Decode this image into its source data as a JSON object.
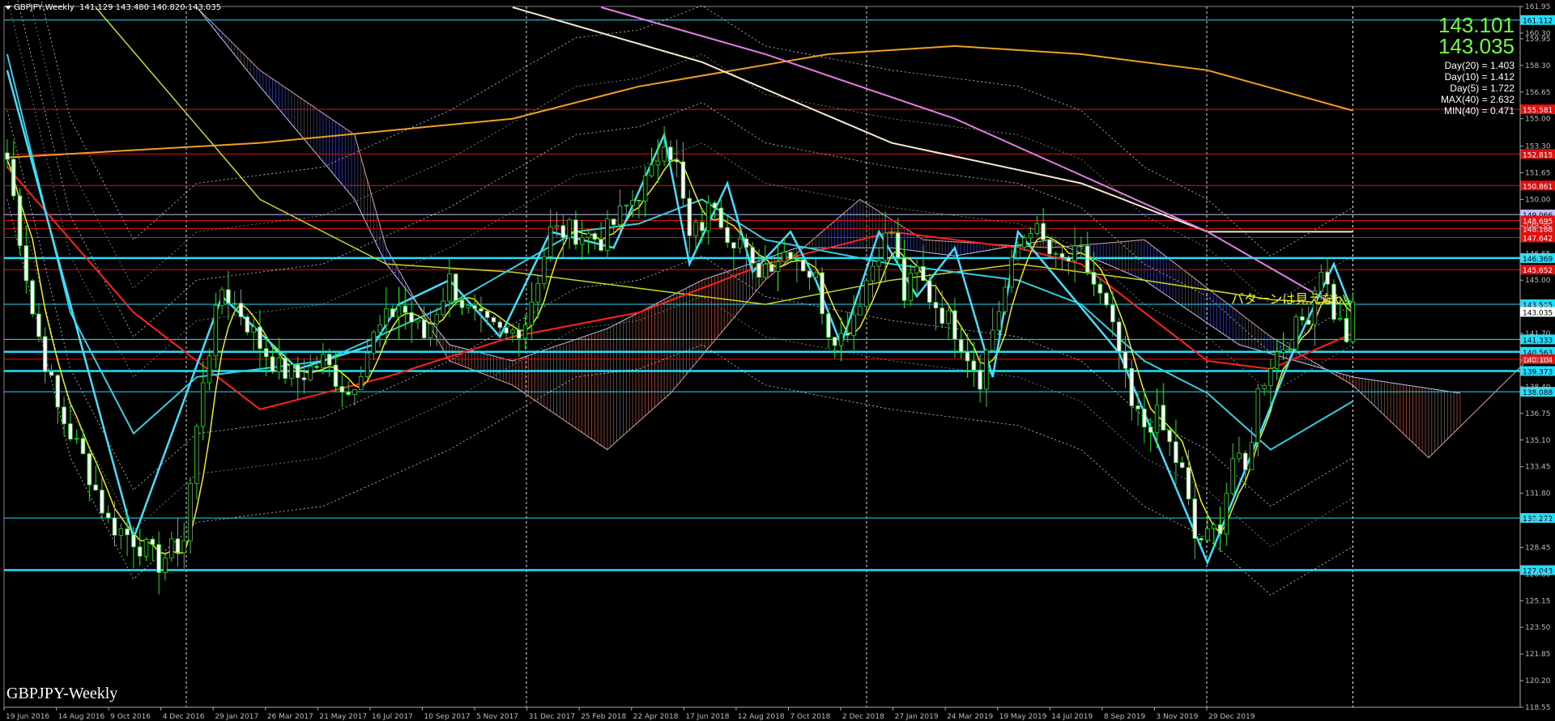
{
  "header": {
    "symbol": "GBPJPY,Weekly",
    "ohlc": "141.129 143.480 140.820 143.035"
  },
  "price_display": {
    "bid": "143.101",
    "ask": "143.035"
  },
  "stats": [
    "Day(20) = 1.403",
    "Day(10) = 1.412",
    "Day(5) = 1.722",
    "MAX(40) = 2.632",
    "MIN(40) = 0.471"
  ],
  "watermark": "GBPJPY-Weekly",
  "annotation": "パターンは見えない。",
  "colors": {
    "background": "#000000",
    "bull": "#22dd22",
    "bear": "#ffffff",
    "ma_red": "#ff2020",
    "ma_yellow": "#f0f000",
    "ma_cyan": "#30d0e0",
    "ma_orange": "#f0a020",
    "ma_white": "#ffffff",
    "ma_pink": "#e080e0",
    "level_cyan": "#20e0ff",
    "level_red": "#e01010",
    "cloud_up": "#c06040",
    "cloud_down": "#4050c0",
    "price_green": "#6cff3a"
  },
  "chart_data": {
    "type": "candlestick",
    "title": "GBPJPY-Weekly",
    "ylim": [
      118.55,
      161.95
    ],
    "y_ticks": [
      "161.95",
      "160.30",
      "159.95",
      "158.30",
      "156.65",
      "155.00",
      "153.30",
      "151.65",
      "150.00",
      "148.35",
      "146.65",
      "145.00",
      "143.35",
      "141.70",
      "140.05",
      "138.40",
      "136.75",
      "135.10",
      "133.45",
      "131.80",
      "130.15",
      "128.45",
      "126.80",
      "125.15",
      "123.50",
      "121.85",
      "120.20",
      "118.55"
    ],
    "x_labels": [
      "19 Jun 2016",
      "14 Aug 2016",
      "9 Oct 2016",
      "4 Dec 2016",
      "29 Jan 2017",
      "26 Mar 2017",
      "21 May 2017",
      "16 Jul 2017",
      "10 Sep 2017",
      "5 Nov 2017",
      "31 Dec 2017",
      "25 Feb 2018",
      "22 Apr 2018",
      "17 Jun 2018",
      "12 Aug 2018",
      "7 Oct 2018",
      "2 Dec 2018",
      "27 Jan 2019",
      "24 Mar 2019",
      "19 May 2019",
      "14 Jul 2019",
      "8 Sep 2019",
      "3 Nov 2019",
      "29 Dec 2019"
    ],
    "horizontal_levels": [
      {
        "value": 161.112,
        "label": "161.112",
        "color": "#20e0ff"
      },
      {
        "value": 155.581,
        "label": "155.581",
        "color": "#e01010"
      },
      {
        "value": 152.815,
        "label": "152.815",
        "color": "#e01010"
      },
      {
        "value": 150.861,
        "label": "150.861",
        "color": "#e01010"
      },
      {
        "value": 149.066,
        "label": "149.066",
        "color": "#c0c0ff"
      },
      {
        "value": 148.695,
        "label": "148.695",
        "color": "#e01010"
      },
      {
        "value": 148.188,
        "label": "148.188",
        "color": "#e01010"
      },
      {
        "value": 147.642,
        "label": "147.642",
        "color": "#e01010"
      },
      {
        "value": 146.369,
        "label": "146.369",
        "color": "#20e0ff"
      },
      {
        "value": 145.652,
        "label": "145.652",
        "color": "#e01010"
      },
      {
        "value": 143.505,
        "label": "143.505",
        "color": "#20e0ff"
      },
      {
        "value": 141.333,
        "label": "141.333",
        "color": "#20e0ff"
      },
      {
        "value": 140.563,
        "label": "140.563",
        "color": "#20e0ff"
      },
      {
        "value": 140.104,
        "label": "140.104",
        "color": "#e01010"
      },
      {
        "value": 139.373,
        "label": "139.373",
        "color": "#20e0ff"
      },
      {
        "value": 138.088,
        "label": "138.088",
        "color": "#20e0ff"
      },
      {
        "value": 130.272,
        "label": "130.272",
        "color": "#20e0ff"
      },
      {
        "value": 127.043,
        "label": "127.043",
        "color": "#20e0ff"
      }
    ],
    "current_price": {
      "value": 143.035,
      "label": "143.035"
    },
    "candles_close_keypoints": [
      [
        0,
        152.5
      ],
      [
        4,
        143
      ],
      [
        8,
        137
      ],
      [
        12,
        134
      ],
      [
        16,
        130
      ],
      [
        20,
        129
      ],
      [
        24,
        127.5
      ],
      [
        28,
        129
      ],
      [
        31,
        139
      ],
      [
        34,
        144.5
      ],
      [
        37,
        143
      ],
      [
        40,
        141
      ],
      [
        43,
        139.5
      ],
      [
        46,
        139
      ],
      [
        50,
        140
      ],
      [
        54,
        138
      ],
      [
        58,
        141.5
      ],
      [
        62,
        143.5
      ],
      [
        66,
        141.5
      ],
      [
        70,
        145
      ],
      [
        73,
        143
      ],
      [
        76,
        142
      ],
      [
        79,
        141.5
      ],
      [
        82,
        142.5
      ],
      [
        86,
        148
      ],
      [
        90,
        148
      ],
      [
        94,
        147.5
      ],
      [
        98,
        149.5
      ],
      [
        102,
        151.5
      ],
      [
        104,
        154
      ],
      [
        106,
        152
      ],
      [
        108,
        147.5
      ],
      [
        110,
        148.5
      ],
      [
        112,
        150
      ],
      [
        114,
        148
      ],
      [
        116,
        147.5
      ],
      [
        118,
        145.5
      ],
      [
        120,
        146
      ],
      [
        124,
        147
      ],
      [
        128,
        145
      ],
      [
        130,
        142
      ],
      [
        132,
        141.5
      ],
      [
        134,
        143
      ],
      [
        138,
        147
      ],
      [
        140,
        148
      ],
      [
        142,
        144
      ],
      [
        144,
        145.5
      ],
      [
        146,
        144
      ],
      [
        150,
        142
      ],
      [
        152,
        140.5
      ],
      [
        154,
        139
      ],
      [
        156,
        142
      ],
      [
        160,
        147
      ],
      [
        162,
        148.5
      ],
      [
        166,
        146
      ],
      [
        170,
        146.5
      ],
      [
        174,
        143
      ],
      [
        176,
        140.5
      ],
      [
        178,
        137
      ],
      [
        180,
        136
      ],
      [
        182,
        136.5
      ],
      [
        186,
        133
      ],
      [
        188,
        129
      ],
      [
        190,
        129
      ],
      [
        192,
        130
      ],
      [
        194,
        134
      ],
      [
        196,
        133
      ],
      [
        198,
        138
      ],
      [
        200,
        140
      ],
      [
        202,
        141
      ],
      [
        206,
        143
      ],
      [
        208,
        146
      ],
      [
        210,
        143
      ],
      [
        212,
        141.5
      ],
      [
        213,
        143
      ]
    ],
    "ma_red": [
      [
        0,
        152
      ],
      [
        20,
        143
      ],
      [
        40,
        137
      ],
      [
        60,
        139
      ],
      [
        80,
        141.5
      ],
      [
        100,
        143
      ],
      [
        120,
        146
      ],
      [
        140,
        148
      ],
      [
        160,
        147
      ],
      [
        170,
        146
      ],
      [
        180,
        143
      ],
      [
        190,
        140
      ],
      [
        200,
        139.5
      ],
      [
        213,
        141.7
      ]
    ],
    "ma_yellow_long": [
      [
        14,
        161.9
      ],
      [
        40,
        150
      ],
      [
        60,
        146
      ],
      [
        80,
        145.5
      ],
      [
        100,
        144.5
      ],
      [
        120,
        143.5
      ],
      [
        140,
        145
      ],
      [
        160,
        146
      ],
      [
        180,
        145
      ],
      [
        200,
        143.8
      ],
      [
        213,
        143.5
      ]
    ],
    "ma_cyan": [
      [
        0,
        159
      ],
      [
        10,
        143
      ],
      [
        20,
        135.5
      ],
      [
        30,
        139
      ],
      [
        50,
        140
      ],
      [
        70,
        143.5
      ],
      [
        90,
        148
      ],
      [
        100,
        148.5
      ],
      [
        110,
        150
      ],
      [
        120,
        147.5
      ],
      [
        140,
        146
      ],
      [
        160,
        145
      ],
      [
        170,
        143.5
      ],
      [
        180,
        140
      ],
      [
        190,
        138
      ],
      [
        200,
        134.5
      ],
      [
        213,
        137.5
      ]
    ],
    "ma_orange": [
      [
        0,
        152.6
      ],
      [
        40,
        153.5
      ],
      [
        80,
        155
      ],
      [
        100,
        157
      ],
      [
        130,
        159
      ],
      [
        150,
        159.5
      ],
      [
        170,
        159
      ],
      [
        190,
        158
      ],
      [
        213,
        155.5
      ]
    ],
    "ma_white": [
      [
        80,
        161.9
      ],
      [
        110,
        158.5
      ],
      [
        140,
        153.5
      ],
      [
        170,
        151
      ],
      [
        190,
        148
      ],
      [
        213,
        148
      ]
    ],
    "ma_pink": [
      [
        94,
        161.9
      ],
      [
        120,
        159
      ],
      [
        150,
        155
      ],
      [
        170,
        151.5
      ],
      [
        190,
        148
      ],
      [
        210,
        143.5
      ]
    ],
    "ichimoku_span_a": [
      [
        30,
        161.9
      ],
      [
        40,
        157
      ],
      [
        55,
        150
      ],
      [
        60,
        146
      ],
      [
        70,
        141
      ],
      [
        80,
        140
      ],
      [
        95,
        142
      ],
      [
        110,
        145
      ],
      [
        125,
        147
      ],
      [
        140,
        147
      ],
      [
        150,
        146.5
      ],
      [
        165,
        147.5
      ],
      [
        180,
        145
      ],
      [
        195,
        141
      ],
      [
        213,
        139
      ],
      [
        230,
        138
      ]
    ],
    "ichimoku_span_b": [
      [
        30,
        161.9
      ],
      [
        40,
        158
      ],
      [
        55,
        154
      ],
      [
        60,
        147
      ],
      [
        70,
        140
      ],
      [
        80,
        138.5
      ],
      [
        95,
        134.5
      ],
      [
        105,
        138
      ],
      [
        120,
        145
      ],
      [
        135,
        150
      ],
      [
        145,
        147.5
      ],
      [
        165,
        147
      ],
      [
        180,
        147.5
      ],
      [
        200,
        141.5
      ],
      [
        213,
        138.5
      ],
      [
        225,
        134
      ],
      [
        240,
        139.8
      ]
    ]
  }
}
